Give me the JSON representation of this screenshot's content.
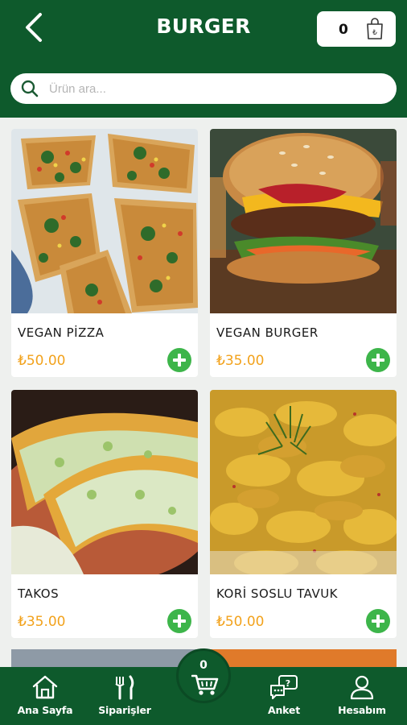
{
  "header": {
    "title": "BURGER",
    "cart_count": "0",
    "back_icon": "chevron-left-icon",
    "bag_icon": "shopping-bag-icon"
  },
  "search": {
    "placeholder": "Ürün ara...",
    "value": ""
  },
  "products": [
    {
      "name": "VEGAN PİZZA",
      "price": "₺50.00",
      "image": "vegan-pizza-photo"
    },
    {
      "name": "VEGAN BURGER",
      "price": "₺35.00",
      "image": "vegan-burger-photo"
    },
    {
      "name": "TAKOS",
      "price": "₺35.00",
      "image": "tacos-photo"
    },
    {
      "name": "KORİ SOSLU TAVUK",
      "price": "₺50.00",
      "image": "curry-chicken-photo"
    }
  ],
  "bottom_nav": {
    "items": [
      {
        "label": "Ana Sayfa",
        "icon": "home-icon"
      },
      {
        "label": "Siparişler",
        "icon": "fork-knife-icon"
      },
      {
        "label": "Anket",
        "icon": "survey-icon"
      },
      {
        "label": "Hesabım",
        "icon": "user-icon"
      }
    ],
    "cart_count": "0"
  },
  "colors": {
    "brand_green": "#0e5a2c",
    "add_button": "#3db54a",
    "price": "#f2a21c",
    "background": "#eef0ee"
  }
}
